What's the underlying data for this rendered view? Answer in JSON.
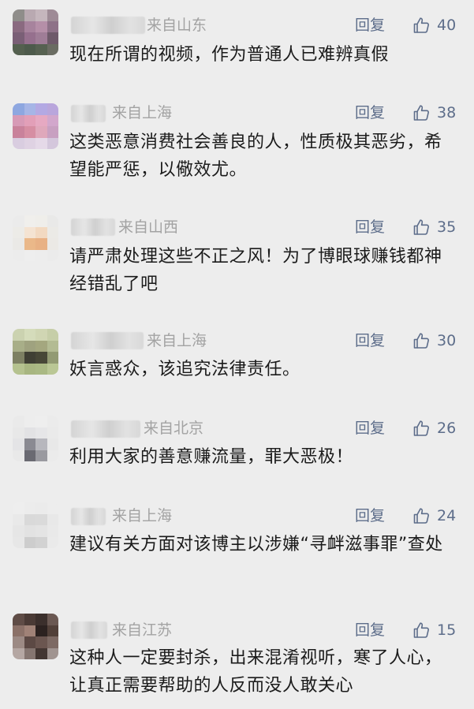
{
  "reply_label": "回复",
  "colors": {
    "reply": "#5d6d8a",
    "location": "#a3a3a3",
    "background": "#ededed"
  },
  "comments": [
    {
      "location": "来自山东",
      "likes": "40",
      "text": "现在所谓的视频，作为普通人已难辨真假"
    },
    {
      "location": "来自上海",
      "likes": "38",
      "text": "这类恶意消费社会善良的人，性质极其恶劣，希望能严惩，以儆效尤。"
    },
    {
      "location": "来自山西",
      "likes": "35",
      "text": "请严肃处理这些不正之风！为了博眼球赚钱都神经错乱了吧"
    },
    {
      "location": "来自上海",
      "likes": "30",
      "text": "妖言惑众，该追究法律责任。"
    },
    {
      "location": "来自北京",
      "likes": "26",
      "text": "利用大家的善意赚流量，罪大恶极！"
    },
    {
      "location": "来自上海",
      "likes": "24",
      "text": "建议有关方面对该博主以涉嫌“寻衅滋事罪”查处"
    },
    {
      "location": "来自江苏",
      "likes": "15",
      "text": "这种人一定要封杀，出来混淆视听，寒了人心，让真正需要帮助的人反而没人敢关心"
    }
  ]
}
